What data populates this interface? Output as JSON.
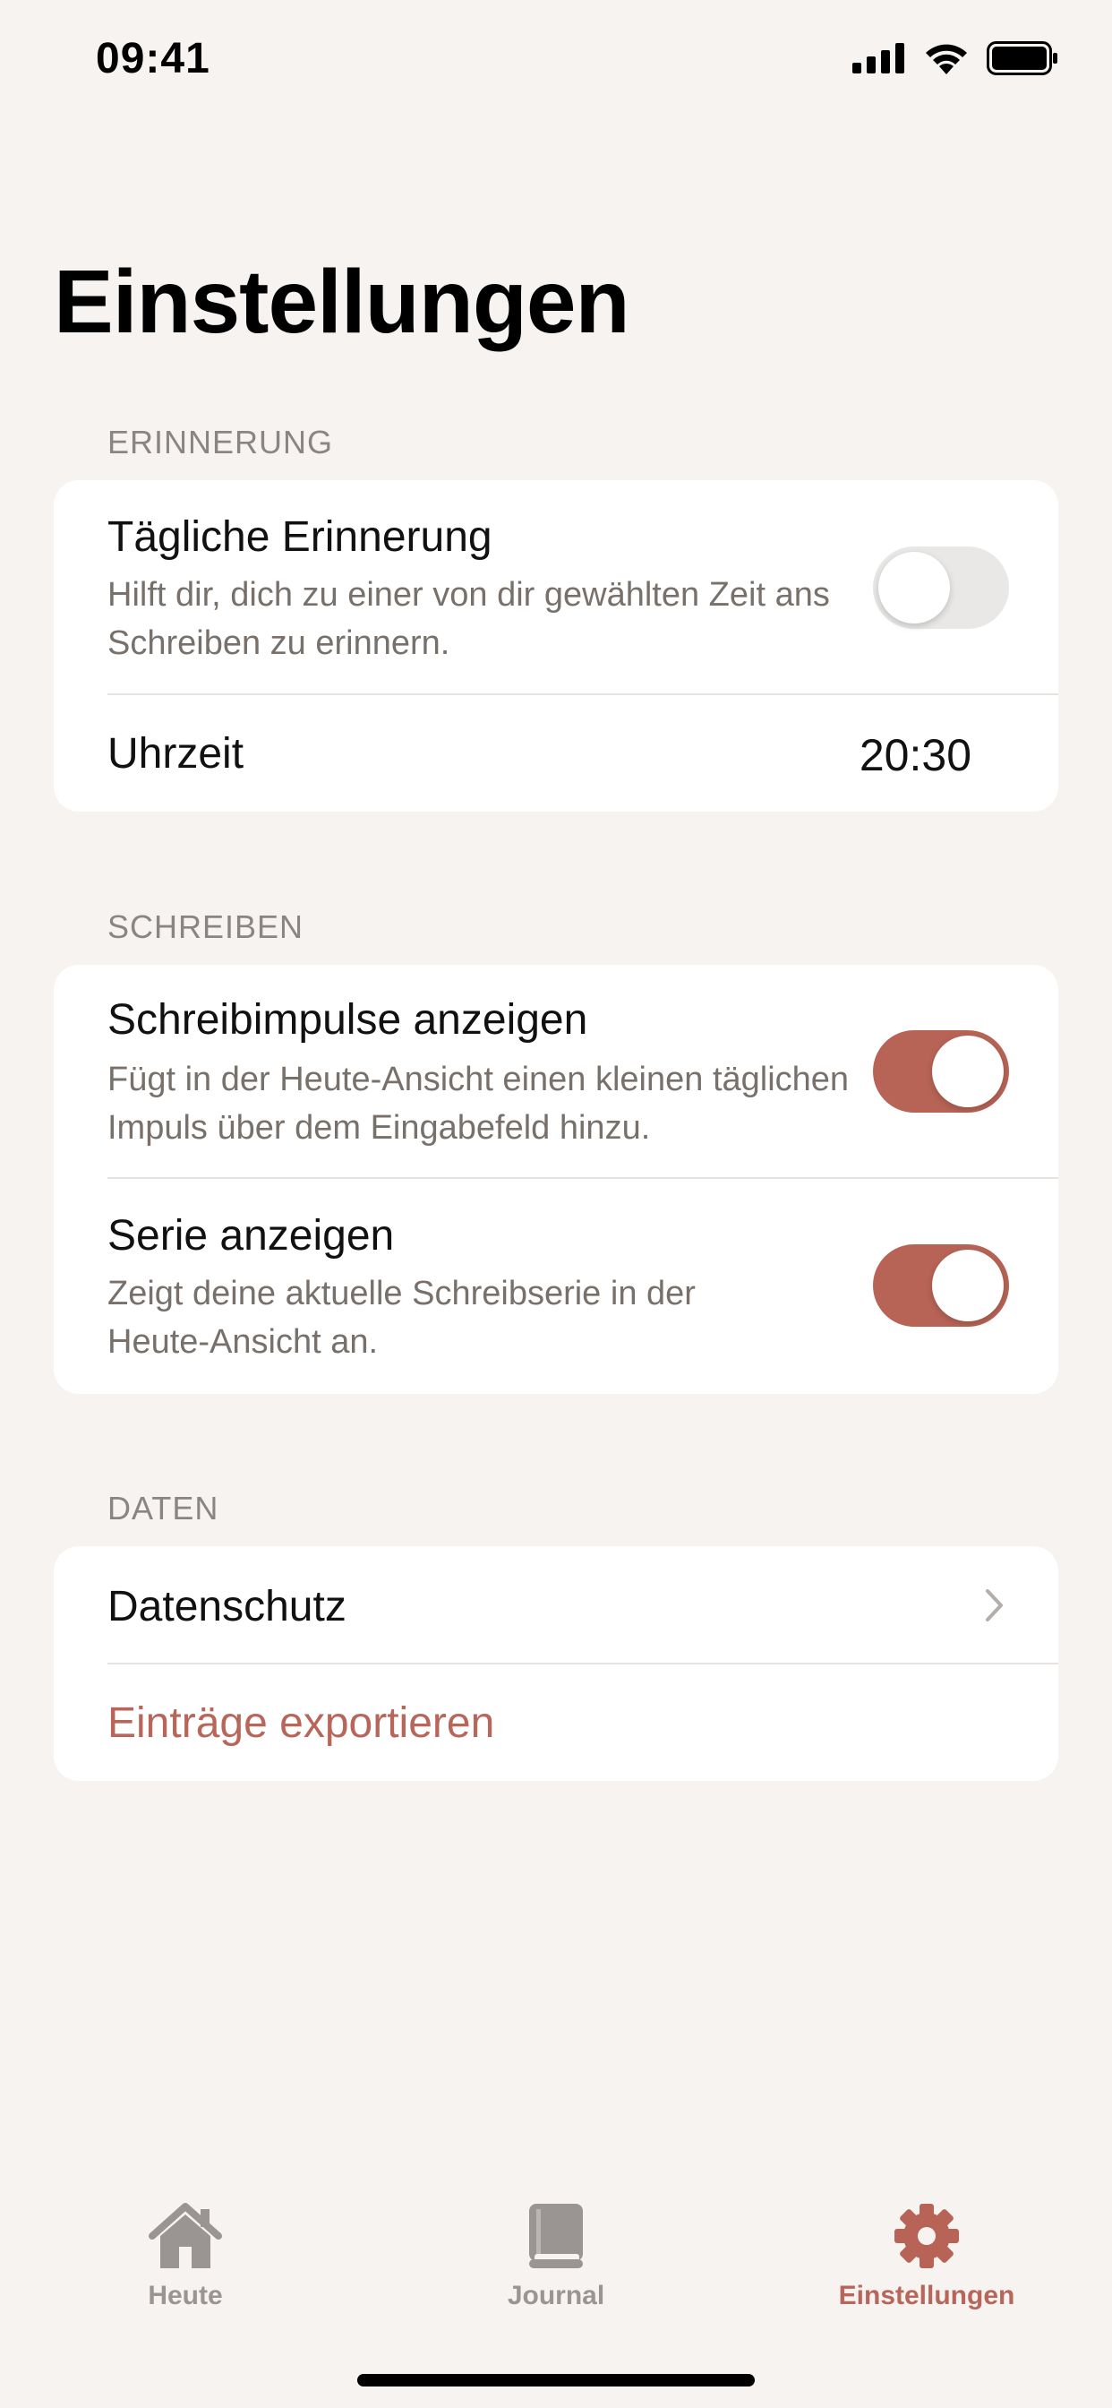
{
  "status_bar": {
    "time": "09:41"
  },
  "page": {
    "title": "Einstellungen"
  },
  "sections": {
    "reminder": {
      "header": "ERINNERUNG",
      "daily_reminder": {
        "title": "Tägliche Erinnerung",
        "description": "Hilft dir, dich zu einer von dir gewählten Zeit ans Schreiben zu erinnern.",
        "enabled": false
      },
      "time": {
        "label": "Uhrzeit",
        "value": "20:30"
      }
    },
    "writing": {
      "header": "SCHREIBEN",
      "prompts": {
        "title": "Schreibimpulse anzeigen",
        "description": "Fügt in der Heute-Ansicht einen kleinen täglichen Impuls über dem Eingabefeld hinzu.",
        "enabled": true
      },
      "streak": {
        "title": "Serie anzeigen",
        "description": "Zeigt deine aktuelle Schreibserie in der Heute-Ansicht an.",
        "enabled": true
      }
    },
    "data": {
      "header": "DATEN",
      "privacy": {
        "label": "Datenschutz"
      },
      "export": {
        "label": "Einträge exportieren"
      }
    }
  },
  "tab_bar": {
    "tabs": [
      {
        "label": "Heute",
        "icon": "house-icon",
        "active": false
      },
      {
        "label": "Journal",
        "icon": "book-icon",
        "active": false
      },
      {
        "label": "Einstellungen",
        "icon": "gear-icon",
        "active": true
      }
    ]
  },
  "colors": {
    "background": "#f6f3f1",
    "accent": "#b76456",
    "accent_text": "#b8655a",
    "toggle_off": "#e9e8e6",
    "inactive_tab": "#9a9592"
  }
}
